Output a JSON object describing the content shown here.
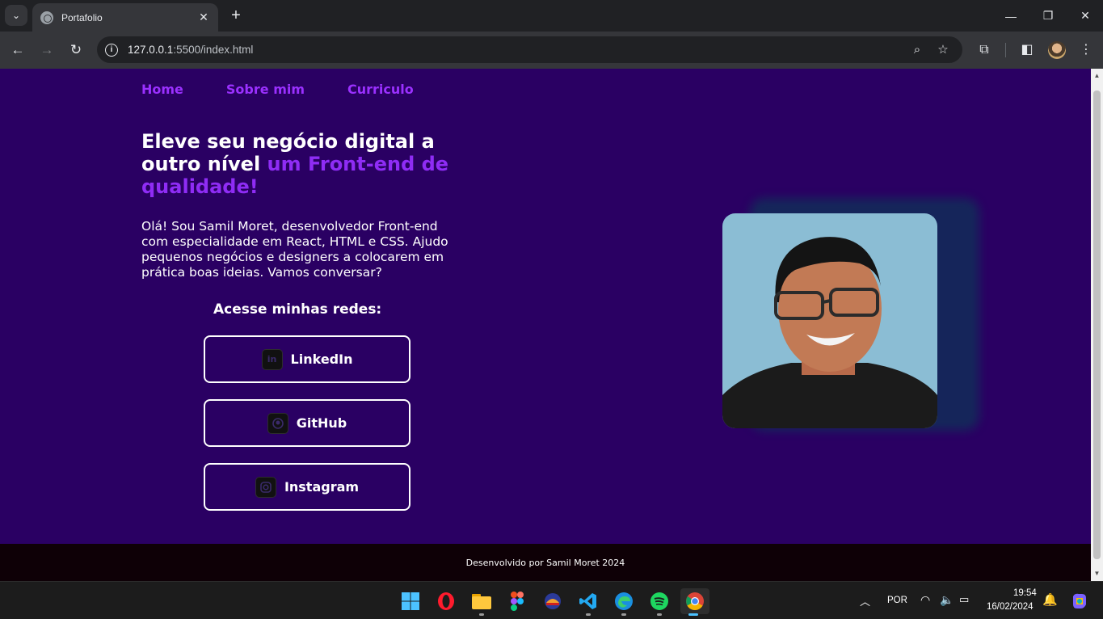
{
  "browser": {
    "tab_title": "Portafolio",
    "url_host": "127.0.0.1",
    "url_path": ":5500/index.html"
  },
  "site": {
    "nav": [
      "Home",
      "Sobre mim",
      "Curriculo"
    ],
    "hero_title_white": "Eleve seu negócio digital a outro nível",
    "hero_title_accent": "um Front-end de qualidade!",
    "intro": "Olá! Sou Samil Moret, desenvolvedor Front-end com especialidade em React, HTML e CSS. Ajudo pequenos negócios e designers a colocarem em prática boas ideias. Vamos conversar?",
    "networks_title": "Acesse minhas redes:",
    "networks": [
      {
        "label": "LinkedIn",
        "icon": "linkedin-icon"
      },
      {
        "label": "GitHub",
        "icon": "github-icon"
      },
      {
        "label": "Instagram",
        "icon": "instagram-icon"
      }
    ],
    "footer": "Desenvolvido por Samil Moret 2024"
  },
  "taskbar": {
    "language": "POR",
    "time": "19:54",
    "date": "16/02/2024"
  },
  "colors": {
    "page_bg": "#2a0063",
    "accent": "#8f2cf5",
    "footer_bg": "#0e0006"
  }
}
